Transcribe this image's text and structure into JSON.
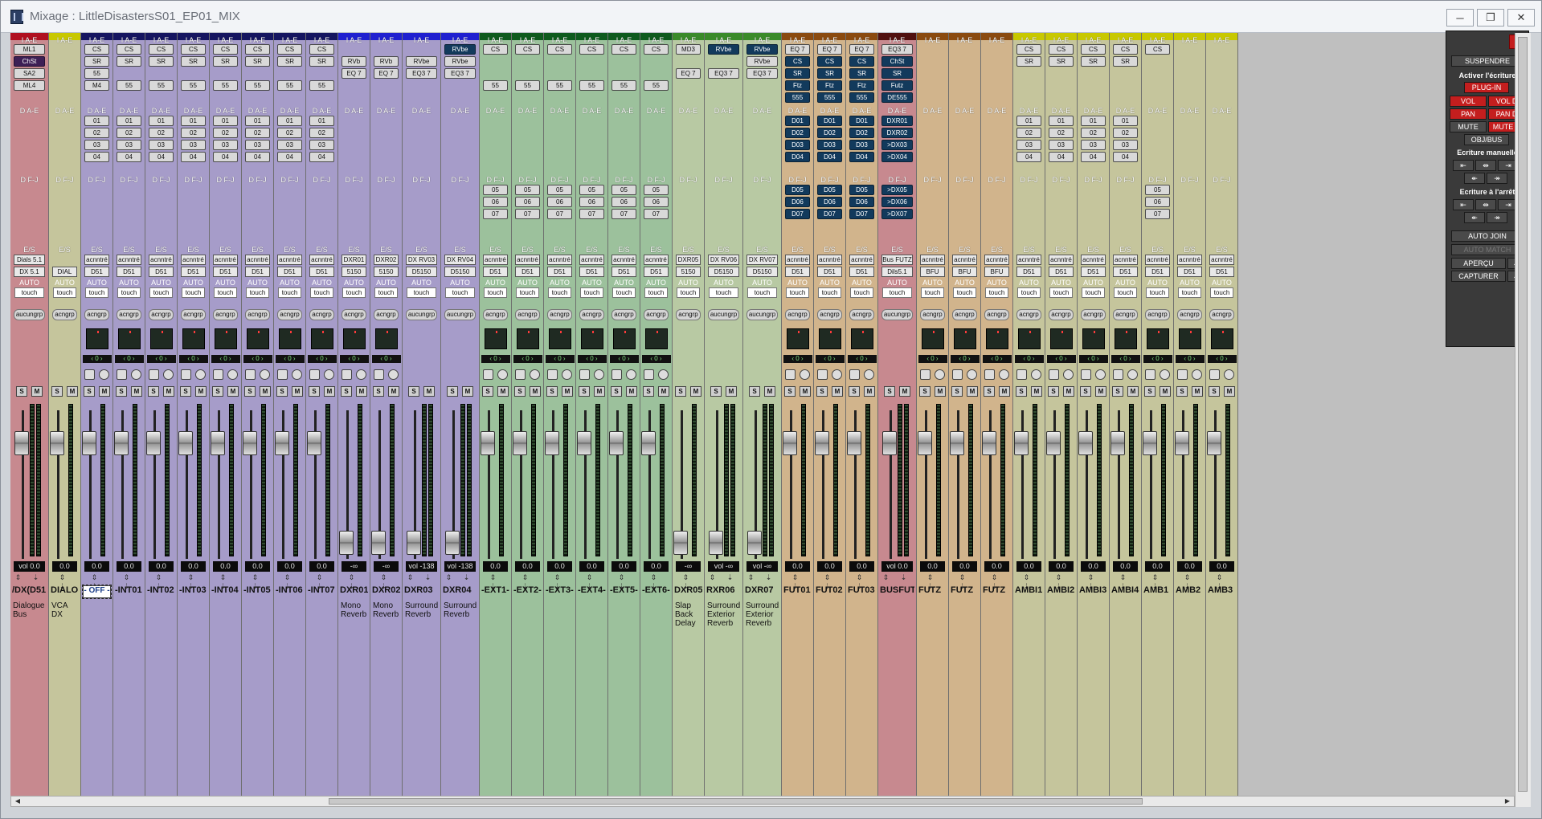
{
  "window": {
    "title": "Mixage : LittleDisastersS01_EP01_MIX",
    "minimize_label": "─",
    "restore_label": "❐",
    "close_label": "✕"
  },
  "section_labels": {
    "inserts_ae": "I A-E",
    "sends_ae": "D A-E",
    "sends_fj": "D F-J",
    "io": "E/S",
    "auto": "AUTO"
  },
  "strips": [
    {
      "name": "/DX(D51",
      "color": "#c7898f",
      "bar": "#b01020",
      "io1": "Dials 5.1",
      "io2": "DX 5.1",
      "auto": "touch",
      "group": "aucungrp",
      "vol": "vol    0.0",
      "inserts": [
        "ML1",
        "ChSt",
        "SA2",
        "ML4"
      ],
      "sends": [],
      "sends2": [],
      "comment": "Dialogue Bus",
      "hasPan": false,
      "wide": true
    },
    {
      "name": "DIALO",
      "color": "#c5c59c",
      "bar": "#c8c800",
      "io1": "",
      "io2": "DIAL",
      "auto": "touch",
      "group": "acngrp",
      "vol": "0.0",
      "inserts": [],
      "sends": [],
      "sends2": [],
      "comment": "VCA DX",
      "hasPan": false,
      "isVca": true
    },
    {
      "name": "- OFF -",
      "color": "#a69cc9",
      "bar": "#151560",
      "io1": "acnntré",
      "io2": "D51",
      "auto": "touch",
      "group": "acngrp",
      "vol": "0.0",
      "inserts": [
        "CS",
        "SR",
        "55",
        "M4"
      ],
      "sends": [
        "01",
        "02",
        "03",
        "04"
      ],
      "sends2": [],
      "comment": "",
      "hasPan": true,
      "sel": true
    },
    {
      "name": "-INT01",
      "color": "#a69cc9",
      "bar": "#151560",
      "io1": "acnntré",
      "io2": "D51",
      "auto": "touch",
      "group": "acngrp",
      "vol": "0.0",
      "inserts": [
        "CS",
        "SR",
        "",
        "55"
      ],
      "sends": [
        "01",
        "02",
        "03",
        "04"
      ],
      "sends2": [],
      "comment": "",
      "hasPan": true
    },
    {
      "name": "-INT02",
      "color": "#a69cc9",
      "bar": "#151560",
      "io1": "acnntré",
      "io2": "D51",
      "auto": "touch",
      "group": "acngrp",
      "vol": "0.0",
      "inserts": [
        "CS",
        "SR",
        "",
        "55"
      ],
      "sends": [
        "01",
        "02",
        "03",
        "04"
      ],
      "sends2": [],
      "comment": "",
      "hasPan": true
    },
    {
      "name": "-INT03",
      "color": "#a69cc9",
      "bar": "#151560",
      "io1": "acnntré",
      "io2": "D51",
      "auto": "touch",
      "group": "acngrp",
      "vol": "0.0",
      "inserts": [
        "CS",
        "SR",
        "",
        "55"
      ],
      "sends": [
        "01",
        "02",
        "03",
        "04"
      ],
      "sends2": [],
      "comment": "",
      "hasPan": true
    },
    {
      "name": "-INT04",
      "color": "#a69cc9",
      "bar": "#151560",
      "io1": "acnntré",
      "io2": "D51",
      "auto": "touch",
      "group": "acngrp",
      "vol": "0.0",
      "inserts": [
        "CS",
        "SR",
        "",
        "55"
      ],
      "sends": [
        "01",
        "02",
        "03",
        "04"
      ],
      "sends2": [],
      "comment": "",
      "hasPan": true
    },
    {
      "name": "-INT05",
      "color": "#a69cc9",
      "bar": "#151560",
      "io1": "acnntré",
      "io2": "D51",
      "auto": "touch",
      "group": "acngrp",
      "vol": "0.0",
      "inserts": [
        "CS",
        "SR",
        "",
        "55"
      ],
      "sends": [
        "01",
        "02",
        "03",
        "04"
      ],
      "sends2": [],
      "comment": "",
      "hasPan": true
    },
    {
      "name": "-INT06",
      "color": "#a69cc9",
      "bar": "#151560",
      "io1": "acnntré",
      "io2": "D51",
      "auto": "touch",
      "group": "acngrp",
      "vol": "0.0",
      "inserts": [
        "CS",
        "SR",
        "",
        "55"
      ],
      "sends": [
        "01",
        "02",
        "03",
        "04"
      ],
      "sends2": [],
      "comment": "",
      "hasPan": true
    },
    {
      "name": "-INT07",
      "color": "#a69cc9",
      "bar": "#151560",
      "io1": "acnntré",
      "io2": "D51",
      "auto": "touch",
      "group": "acngrp",
      "vol": "0.0",
      "inserts": [
        "CS",
        "SR",
        "",
        "55"
      ],
      "sends": [
        "01",
        "02",
        "03",
        "04"
      ],
      "sends2": [],
      "comment": "",
      "hasPan": true
    },
    {
      "name": "DXR01",
      "color": "#a69cc9",
      "bar": "#2020d0",
      "io1": "DXR01",
      "io2": "5150",
      "auto": "touch",
      "group": "acngrp",
      "vol": "-∞",
      "inserts": [
        "",
        "RVb",
        "EQ 7"
      ],
      "sends": [],
      "sends2": [],
      "comment": "Mono Reverb",
      "hasPan": true,
      "low": true
    },
    {
      "name": "DXR02",
      "color": "#a69cc9",
      "bar": "#2020d0",
      "io1": "DXR02",
      "io2": "5150",
      "auto": "touch",
      "group": "acngrp",
      "vol": "-∞",
      "inserts": [
        "",
        "RVb",
        "EQ 7"
      ],
      "sends": [],
      "sends2": [],
      "comment": "Mono Reverb",
      "hasPan": true,
      "low": true
    },
    {
      "name": "DXR03",
      "color": "#a69cc9",
      "bar": "#2020d0",
      "io1": "DX RV03",
      "io2": "D5150",
      "auto": "touch",
      "group": "aucungrp",
      "vol": "vol  -138",
      "inserts": [
        "",
        "RVbe",
        "EQ3 7"
      ],
      "sends": [],
      "sends2": [],
      "comment": "Surround Reverb",
      "hasPan": false,
      "low": true,
      "wide": true
    },
    {
      "name": "DXR04",
      "color": "#a69cc9",
      "bar": "#2020d0",
      "io1": "DX RV04",
      "io2": "D5150",
      "auto": "touch",
      "group": "aucungrp",
      "vol": "vol  -138",
      "inserts": [
        "RVbe",
        "RVbe",
        "EQ3 7"
      ],
      "sends": [],
      "sends2": [],
      "comment": "Surround Reverb",
      "hasPan": false,
      "low": true,
      "wide": true
    },
    {
      "name": "-EXT1-",
      "color": "#9cc19c",
      "bar": "#0e5a1e",
      "io1": "acnntré",
      "io2": "D51",
      "auto": "touch",
      "group": "acngrp",
      "vol": "0.0",
      "inserts": [
        "CS",
        "",
        "",
        "55"
      ],
      "sends": [],
      "sends2": [
        "05",
        "06",
        "07"
      ],
      "comment": "",
      "hasPan": true
    },
    {
      "name": "-EXT2-",
      "color": "#9cc19c",
      "bar": "#0e5a1e",
      "io1": "acnntré",
      "io2": "D51",
      "auto": "touch",
      "group": "acngrp",
      "vol": "0.0",
      "inserts": [
        "CS",
        "",
        "",
        "55"
      ],
      "sends": [],
      "sends2": [
        "05",
        "06",
        "07"
      ],
      "comment": "",
      "hasPan": true
    },
    {
      "name": "-EXT3-",
      "color": "#9cc19c",
      "bar": "#0e5a1e",
      "io1": "acnntré",
      "io2": "D51",
      "auto": "touch",
      "group": "acngrp",
      "vol": "0.0",
      "inserts": [
        "CS",
        "",
        "",
        "55"
      ],
      "sends": [],
      "sends2": [
        "05",
        "06",
        "07"
      ],
      "comment": "",
      "hasPan": true
    },
    {
      "name": "-EXT4-",
      "color": "#9cc19c",
      "bar": "#0e5a1e",
      "io1": "acnntré",
      "io2": "D51",
      "auto": "touch",
      "group": "acngrp",
      "vol": "0.0",
      "inserts": [
        "CS",
        "",
        "",
        "55"
      ],
      "sends": [],
      "sends2": [
        "05",
        "06",
        "07"
      ],
      "comment": "",
      "hasPan": true
    },
    {
      "name": "-EXT5-",
      "color": "#9cc19c",
      "bar": "#0e5a1e",
      "io1": "acnntré",
      "io2": "D51",
      "auto": "touch",
      "group": "acngrp",
      "vol": "0.0",
      "inserts": [
        "CS",
        "",
        "",
        "55"
      ],
      "sends": [],
      "sends2": [
        "05",
        "06",
        "07"
      ],
      "comment": "",
      "hasPan": true
    },
    {
      "name": "-EXT6-",
      "color": "#9cc19c",
      "bar": "#0e5a1e",
      "io1": "acnntré",
      "io2": "D51",
      "auto": "touch",
      "group": "acngrp",
      "vol": "0.0",
      "inserts": [
        "CS",
        "",
        "",
        "55"
      ],
      "sends": [],
      "sends2": [
        "05",
        "06",
        "07"
      ],
      "comment": "",
      "hasPan": true
    },
    {
      "name": "DXR05",
      "color": "#b8c9a3",
      "bar": "#3a8a2a",
      "io1": "DXR05",
      "io2": "5150",
      "auto": "touch",
      "group": "acngrp",
      "vol": "-∞",
      "inserts": [
        "MD3",
        "",
        "EQ 7"
      ],
      "sends": [],
      "sends2": [],
      "comment": "Slap Back Delay",
      "hasPan": false,
      "low": true
    },
    {
      "name": "RXR06",
      "color": "#b8c9a3",
      "bar": "#3a8a2a",
      "io1": "DX RV06",
      "io2": "D5150",
      "auto": "touch",
      "group": "aucungrp",
      "vol": "vol   -∞",
      "inserts": [
        "RVbe",
        "",
        "EQ3 7"
      ],
      "sends": [],
      "sends2": [],
      "comment": "Surround Exterior Reverb",
      "hasPan": false,
      "low": true,
      "wide": true
    },
    {
      "name": "DXR07",
      "color": "#b8c9a3",
      "bar": "#3a8a2a",
      "io1": "DX RV07",
      "io2": "D5150",
      "auto": "touch",
      "group": "aucungrp",
      "vol": "vol   -∞",
      "inserts": [
        "RVbe",
        "RVbe",
        "EQ3 7"
      ],
      "sends": [],
      "sends2": [],
      "comment": "Surround Exterior Reverb",
      "hasPan": false,
      "low": true,
      "wide": true
    },
    {
      "name": "FUT01",
      "color": "#d1b48c",
      "bar": "#8a4a10",
      "io1": "acnntré",
      "io2": "D51",
      "auto": "touch",
      "group": "acngrp",
      "vol": "0.0",
      "inserts": [
        "EQ 7",
        "CS",
        "SR",
        "Ftz",
        "555"
      ],
      "sends": [
        "D01",
        "D02",
        "D03",
        "D04"
      ],
      "sends2": [
        "D05",
        "D06",
        "D07"
      ],
      "comment": "",
      "hasPan": true,
      "blueSends": true
    },
    {
      "name": "FUT02",
      "color": "#d1b48c",
      "bar": "#8a4a10",
      "io1": "acnntré",
      "io2": "D51",
      "auto": "touch",
      "group": "acngrp",
      "vol": "0.0",
      "inserts": [
        "EQ 7",
        "CS",
        "SR",
        "Ftz",
        "555"
      ],
      "sends": [
        "D01",
        "D02",
        "D03",
        "D04"
      ],
      "sends2": [
        "D05",
        "D06",
        "D07"
      ],
      "comment": "",
      "hasPan": true,
      "blueSends": true
    },
    {
      "name": "FUT03",
      "color": "#d1b48c",
      "bar": "#8a4a10",
      "io1": "acnntré",
      "io2": "D51",
      "auto": "touch",
      "group": "acngrp",
      "vol": "0.0",
      "inserts": [
        "EQ 7",
        "CS",
        "SR",
        "Ftz",
        "555"
      ],
      "sends": [
        "D01",
        "D02",
        "D03",
        "D04"
      ],
      "sends2": [
        "D05",
        "D06",
        "D07"
      ],
      "comment": "",
      "hasPan": true,
      "blueSends": true
    },
    {
      "name": "BUSFUT",
      "color": "#c7898f",
      "bar": "#501010",
      "io1": "Bus FUTZ",
      "io2": "Dils5.1",
      "auto": "touch",
      "group": "aucungrp",
      "vol": "vol    0.0",
      "inserts": [
        "EQ3 7",
        "ChSt",
        "SR",
        "Futz",
        "DE555"
      ],
      "sends": [
        "DXR01",
        "DXR02",
        ">DX03",
        ">DX04"
      ],
      "sends2": [
        ">DX05",
        ">DX06",
        ">DX07"
      ],
      "comment": "",
      "hasPan": false,
      "blueSends": true,
      "wide": true
    },
    {
      "name": "FUTZ",
      "color": "#d1b48c",
      "bar": "#8a4a10",
      "io1": "acnntré",
      "io2": "BFU",
      "auto": "touch",
      "group": "acngrp",
      "vol": "0.0",
      "inserts": [],
      "sends": [],
      "sends2": [],
      "comment": "",
      "hasPan": true
    },
    {
      "name": "FUTZ",
      "color": "#d1b48c",
      "bar": "#8a4a10",
      "io1": "acnntré",
      "io2": "BFU",
      "auto": "touch",
      "group": "acngrp",
      "vol": "0.0",
      "inserts": [],
      "sends": [],
      "sends2": [],
      "comment": "",
      "hasPan": true
    },
    {
      "name": "FUTZ",
      "color": "#d1b48c",
      "bar": "#8a4a10",
      "io1": "acnntré",
      "io2": "BFU",
      "auto": "touch",
      "group": "acngrp",
      "vol": "0.0",
      "inserts": [],
      "sends": [],
      "sends2": [],
      "comment": "",
      "hasPan": true
    },
    {
      "name": "AMBI1",
      "color": "#c5c59c",
      "bar": "#c8c800",
      "io1": "acnntré",
      "io2": "D51",
      "auto": "touch",
      "group": "acngrp",
      "vol": "0.0",
      "inserts": [
        "CS",
        "SR"
      ],
      "sends": [
        "01",
        "02",
        "03",
        "04"
      ],
      "sends2": [],
      "comment": "",
      "hasPan": true
    },
    {
      "name": "AMBI2",
      "color": "#c5c59c",
      "bar": "#c8c800",
      "io1": "acnntré",
      "io2": "D51",
      "auto": "touch",
      "group": "acngrp",
      "vol": "0.0",
      "inserts": [
        "CS",
        "SR"
      ],
      "sends": [
        "01",
        "02",
        "03",
        "04"
      ],
      "sends2": [],
      "comment": "",
      "hasPan": true
    },
    {
      "name": "AMBI3",
      "color": "#c5c59c",
      "bar": "#c8c800",
      "io1": "acnntré",
      "io2": "D51",
      "auto": "touch",
      "group": "acngrp",
      "vol": "0.0",
      "inserts": [
        "CS",
        "SR"
      ],
      "sends": [
        "01",
        "02",
        "03",
        "04"
      ],
      "sends2": [],
      "comment": "",
      "hasPan": true
    },
    {
      "name": "AMBI4",
      "color": "#c5c59c",
      "bar": "#c8c800",
      "io1": "acnntré",
      "io2": "D51",
      "auto": "touch",
      "group": "acngrp",
      "vol": "0.0",
      "inserts": [
        "CS",
        "SR"
      ],
      "sends": [
        "01",
        "02",
        "03",
        "04"
      ],
      "sends2": [],
      "comment": "",
      "hasPan": true
    },
    {
      "name": "AMB1",
      "color": "#c5c59c",
      "bar": "#c8c800",
      "io1": "acnntré",
      "io2": "D51",
      "auto": "touch",
      "group": "acngrp",
      "vol": "0.0",
      "inserts": [
        "CS"
      ],
      "sends": [],
      "sends2": [
        "05",
        "06",
        "07"
      ],
      "comment": "",
      "hasPan": true
    },
    {
      "name": "AMB2",
      "color": "#c5c59c",
      "bar": "#c8c800",
      "io1": "acnntré",
      "io2": "D51",
      "auto": "touch",
      "group": "acngrp",
      "vol": "0.0",
      "inserts": [],
      "sends": [],
      "sends2": [],
      "comment": "",
      "hasPan": true
    },
    {
      "name": "AMB3",
      "color": "#c5c59c",
      "bar": "#c8c800",
      "io1": "acnntré",
      "io2": "D51",
      "auto": "touch",
      "group": "acngrp",
      "vol": "0.0",
      "inserts": [],
      "sends": [],
      "sends2": [],
      "comment": "",
      "hasPan": true
    }
  ],
  "automation_panel": {
    "close_label": "x",
    "suspend": "SUSPENDRE",
    "enable_writing": "Activer l'écriture",
    "plugin": "PLUG-IN",
    "vol": "VOL",
    "vol_d": "VOL D",
    "pan": "PAN",
    "pan_d": "PAN D",
    "mute": "MUTE",
    "mute_d": "MUTE D",
    "obj_bus": "OBJ/BUS",
    "manual_writing": "Ecriture manuelle",
    "stop_writing": "Ecriture à l'arrêt",
    "auto_join": "AUTO JOIN",
    "auto_match": "AUTO MATCH",
    "preview": "APERÇU",
    "capture": "CAPTURER"
  }
}
